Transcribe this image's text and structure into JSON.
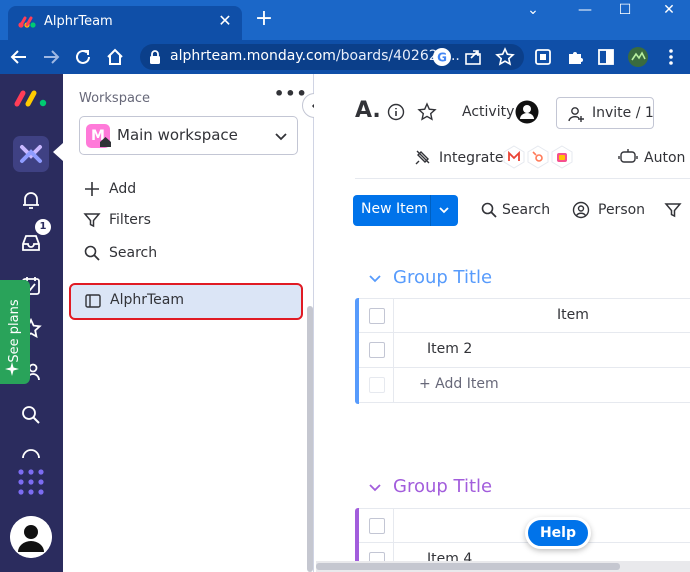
{
  "browser": {
    "tab_title": "AlphrTeam",
    "tab_close": "✕",
    "new_tab": "+",
    "url_host": "alphrteam.monday.com",
    "url_path": "/boards/402620...",
    "window_controls": [
      "⌄",
      "—",
      "☐",
      "✕"
    ]
  },
  "rail": {
    "inbox_badge": "1",
    "see_plans": "See plans"
  },
  "workspace": {
    "heading": "Workspace",
    "more": "•••",
    "badge_letter": "M",
    "name": "Main workspace",
    "actions": [
      "Add",
      "Filters",
      "Search"
    ],
    "board_item": "AlphrTeam"
  },
  "board": {
    "title": "A.",
    "activity": "Activity",
    "invite": "Invite / 1",
    "integrate": "Integrate",
    "automate": "Auton",
    "new_item": "New Item",
    "search": "Search",
    "person": "Person"
  },
  "groups": [
    {
      "title": "Group Title",
      "color": "#579bfc",
      "header": "Item",
      "rows": [
        "Item 2"
      ],
      "add_item": "+ Add Item"
    },
    {
      "title": "Group Title",
      "color": "#a25ddc",
      "rows": [
        "Item 4"
      ]
    }
  ],
  "help": "Help",
  "colors": {
    "browser_blue": "#1b67c8",
    "rail": "#2b2c5e",
    "primary": "#0073ea",
    "see_plans": "#29a35a",
    "highlight": "#e01b24"
  }
}
